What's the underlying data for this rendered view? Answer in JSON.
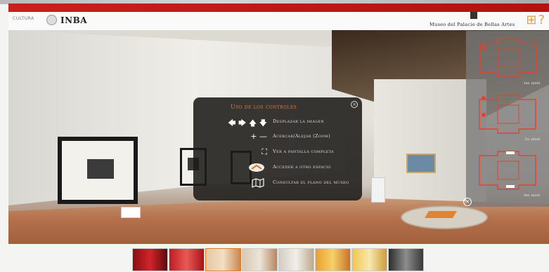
{
  "header": {
    "logo_cultura": "CULTURA",
    "logo_inba": "INBA",
    "museum_name": "Museo del Palacio de Bellas Artes",
    "plan_icon": "floor-plan-icon",
    "help_label": "?"
  },
  "controls_panel": {
    "title": "Uso de los controles",
    "close_icon": "close-icon",
    "rows": [
      {
        "icons": "🡄 🡆 🡅 🡇",
        "label": "Desplazar la imagen",
        "icon": "arrows-icon"
      },
      {
        "icons": "+ —",
        "label": "Acercar/Alejar (Zoom)",
        "icon": "zoom-icon"
      },
      {
        "icons": "⛶",
        "label": "Ver a pantalla completa",
        "icon": "fullscreen-icon"
      },
      {
        "icons": "",
        "label": "Acceder a otro espacio",
        "icon": "floor-arrow-icon"
      },
      {
        "icons": "",
        "label": "Consultar el plano del museo",
        "icon": "map-icon"
      }
    ]
  },
  "floor_plans": [
    {
      "label": "1er. nivel"
    },
    {
      "label": "2o. nivel"
    },
    {
      "label": "3er. nivel"
    }
  ],
  "map_close_icon": "close-icon",
  "thumbnails": [
    {
      "name": "thumb-1"
    },
    {
      "name": "thumb-2"
    },
    {
      "name": "thumb-3"
    },
    {
      "name": "thumb-4"
    },
    {
      "name": "thumb-5"
    },
    {
      "name": "thumb-6"
    },
    {
      "name": "thumb-7"
    },
    {
      "name": "thumb-8"
    }
  ],
  "colors": {
    "accent": "#e37a1f",
    "brand_red": "#c8201d",
    "panel_bg": "#1e1b19"
  }
}
